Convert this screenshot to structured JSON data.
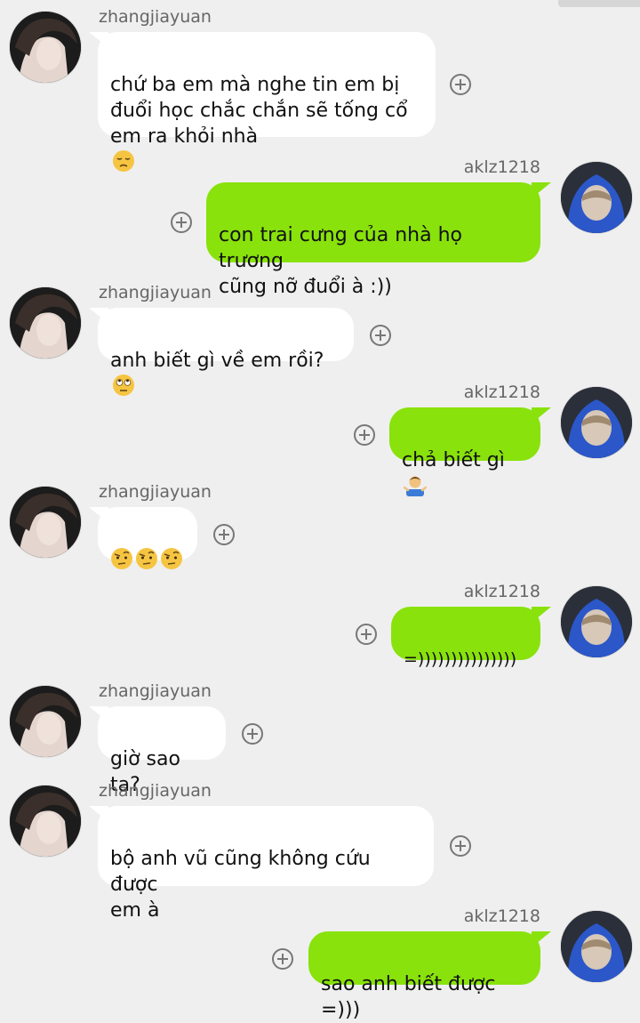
{
  "users": {
    "other": "zhangjiayuan",
    "self": "aklz1218"
  },
  "messages": [
    {
      "from": "other",
      "text": "chứ ba em mà nghe tin em bị\nđuổi học chắc chắn sẽ tống cổ\nem ra khỏi nhà",
      "emoji": [
        "pensive-face"
      ]
    },
    {
      "from": "self",
      "text": "con trai cưng của nhà họ trương\ncũng nỡ đuổi à :))"
    },
    {
      "from": "other",
      "text": "anh biết gì về em rồi?",
      "emoji": [
        "eye-roll-face"
      ]
    },
    {
      "from": "self",
      "text": "chả biết gì",
      "emoji": [
        "person-shrugging"
      ]
    },
    {
      "from": "other",
      "text": "",
      "emoji": [
        "raised-eyebrow-face",
        "raised-eyebrow-face",
        "raised-eyebrow-face"
      ]
    },
    {
      "from": "self",
      "text": "=)))))))))))))))"
    },
    {
      "from": "other",
      "text": "giờ sao ta?"
    },
    {
      "from": "other",
      "text": "bộ anh vũ cũng không cứu được\nem à"
    },
    {
      "from": "self",
      "text": "sao anh biết được =)))"
    }
  ],
  "colors": {
    "background": "#efefef",
    "incoming_bubble": "#ffffff",
    "outgoing_bubble": "#89e20c"
  }
}
